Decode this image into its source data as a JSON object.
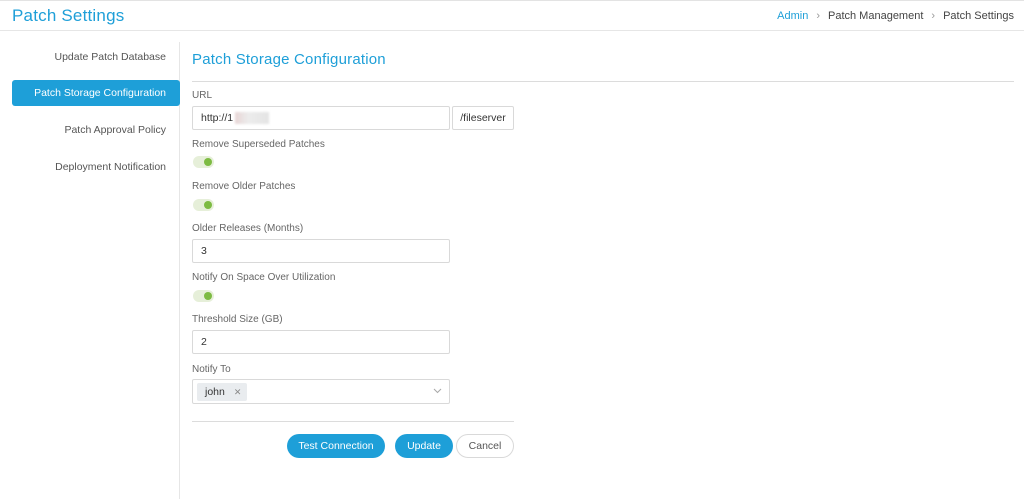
{
  "header": {
    "title": "Patch Settings",
    "breadcrumb": [
      "Admin",
      "Patch Management",
      "Patch Settings"
    ]
  },
  "sidebar": {
    "items": [
      {
        "label": "Update Patch Database",
        "active": false
      },
      {
        "label": "Patch Storage Configuration",
        "active": true
      },
      {
        "label": "Patch Approval Policy",
        "active": false
      },
      {
        "label": "Deployment Notification",
        "active": false
      }
    ]
  },
  "form": {
    "title": "Patch Storage Configuration",
    "url": {
      "label": "URL",
      "value": "http://1",
      "suffix": "/fileserver"
    },
    "remove_superseded": {
      "label": "Remove Superseded Patches",
      "enabled": true
    },
    "remove_older": {
      "label": "Remove Older Patches",
      "enabled": true
    },
    "older_releases": {
      "label": "Older Releases (Months)",
      "value": "3"
    },
    "notify_space": {
      "label": "Notify On Space Over Utilization",
      "enabled": true
    },
    "threshold": {
      "label": "Threshold Size (GB)",
      "value": "2"
    },
    "notify_to": {
      "label": "Notify To",
      "tags": [
        "john"
      ]
    }
  },
  "actions": {
    "test_connection": "Test Connection",
    "update": "Update",
    "cancel": "Cancel"
  },
  "colors": {
    "accent": "#1e9fd8",
    "toggle_on": "#7dbb42"
  }
}
